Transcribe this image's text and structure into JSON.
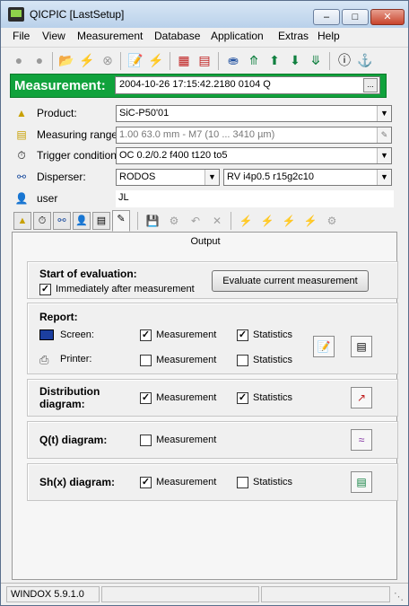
{
  "window": {
    "title": "QICPIC [LastSetup]"
  },
  "menu": [
    "File",
    "View",
    "Measurement",
    "Database",
    "Application",
    "Extras",
    "Help"
  ],
  "measurement": {
    "label": "Measurement:",
    "value": "2004-10-26 17:15:42.2180 0104 Q",
    "dots": "..."
  },
  "properties": {
    "product": {
      "label": "Product:",
      "value": "SiC-P50'01"
    },
    "range": {
      "label": "Measuring range:",
      "value": "1.00 63.0 mm - M7 (10 ... 3410 µm)"
    },
    "trigger": {
      "label": "Trigger condition:",
      "value": "OC 0.2/0.2 f400 t120 to5"
    },
    "disperser": {
      "label": "Disperser:",
      "value1": "RODOS",
      "value2": "RV i4p0.5 r15g2c10"
    },
    "user": {
      "label": "user",
      "value": "JL"
    }
  },
  "panel": {
    "title": "Output",
    "start_eval": {
      "heading": "Start of evaluation:",
      "immediate_label": "Immediately after measurement",
      "immediate_checked": true,
      "evaluate_button": "Evaluate current measurement"
    },
    "report": {
      "heading": "Report:",
      "screen_label": "Screen:",
      "printer_label": "Printer:",
      "measurement_label": "Measurement",
      "statistics_label": "Statistics",
      "screen_measurement": true,
      "screen_statistics": true,
      "printer_measurement": false,
      "printer_statistics": false
    },
    "distribution": {
      "heading_line1": "Distribution",
      "heading_line2": "diagram:",
      "measurement_label": "Measurement",
      "statistics_label": "Statistics",
      "measurement": true,
      "statistics": true
    },
    "qt": {
      "heading": "Q(t) diagram:",
      "measurement_label": "Measurement",
      "measurement": false
    },
    "shx": {
      "heading": "Sh(x) diagram:",
      "measurement_label": "Measurement",
      "statistics_label": "Statistics",
      "measurement": true,
      "statistics": false
    }
  },
  "status": {
    "version": "WINDOX 5.9.1.0"
  },
  "colors": {
    "measurement_bar": "#10a23c",
    "title_bar": "#c9dcf0"
  }
}
